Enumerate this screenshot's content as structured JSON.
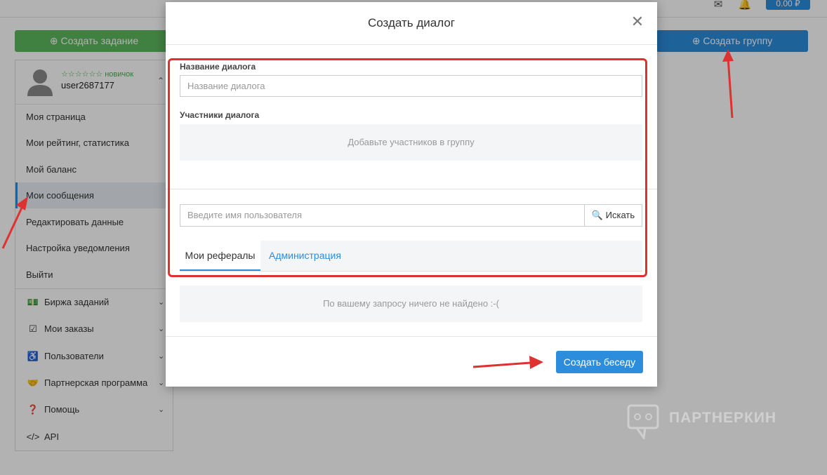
{
  "topbar": {
    "balance": "0.00 ₽"
  },
  "page_buttons": {
    "create_task": "Создать задание",
    "create_group": "Создать группу"
  },
  "profile": {
    "rank": "☆☆☆☆☆☆ новичок",
    "username": "user2687177"
  },
  "nav": [
    "Моя страница",
    "Мои рейтинг, статистика",
    "Мой баланс",
    "Мои сообщения",
    "Редактировать данные",
    "Настройка уведомления",
    "Выйти"
  ],
  "menu": [
    {
      "label": "Биржа заданий",
      "icon": "money-icon"
    },
    {
      "label": "Мои заказы",
      "icon": "checkbox-icon"
    },
    {
      "label": "Пользователи",
      "icon": "accessibility-icon"
    },
    {
      "label": "Партнерская программа",
      "icon": "handshake-icon"
    },
    {
      "label": "Помощь",
      "icon": "question-icon"
    },
    {
      "label": "API",
      "icon": "code-icon"
    }
  ],
  "modal": {
    "title": "Создать диалог",
    "name_label": "Название диалога",
    "name_placeholder": "Название диалога",
    "participants_label": "Участники диалога",
    "participants_empty": "Добавьте участников в группу",
    "user_search_placeholder": "Введите имя пользователя",
    "search_button": "Искать",
    "tabs": [
      "Мои рефералы",
      "Администрация"
    ],
    "no_results": "По вашему запросу ничего не найдено :-(",
    "create_button": "Создать беседу"
  },
  "watermark": "ПАРТНЕРКИН",
  "colors": {
    "primary": "#2c8ddd",
    "success": "#5cb85c",
    "annotation_red": "#e03131"
  }
}
